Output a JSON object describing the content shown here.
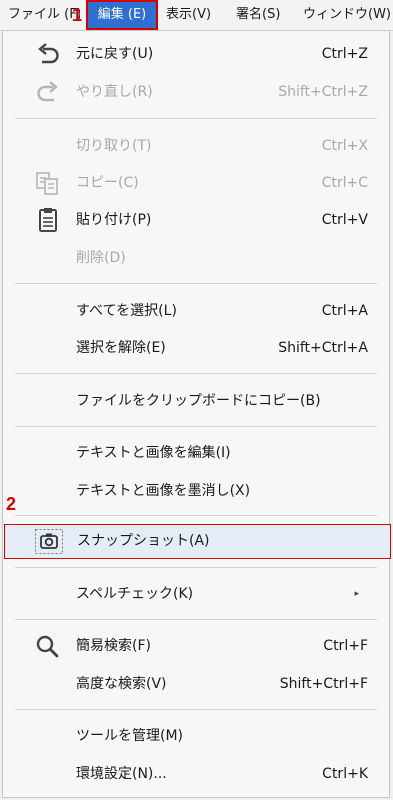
{
  "menubar": {
    "items": [
      {
        "label": "ファイル (F)"
      },
      {
        "label": "編集 (E)"
      },
      {
        "label": "表示(V)"
      },
      {
        "label": "署名(S)"
      },
      {
        "label": "ウィンドウ(W)"
      }
    ]
  },
  "annotations": {
    "step1": "1",
    "step2": "2"
  },
  "edit_menu": {
    "items": [
      {
        "label": "元に戻す(U)",
        "shortcut": "Ctrl+Z",
        "icon": "undo-icon",
        "enabled": true
      },
      {
        "label": "やり直し(R)",
        "shortcut": "Shift+Ctrl+Z",
        "icon": "redo-icon",
        "enabled": false
      },
      {
        "label": "切り取り(T)",
        "shortcut": "Ctrl+X",
        "enabled": false
      },
      {
        "label": "コピー(C)",
        "shortcut": "Ctrl+C",
        "icon": "copy-icon",
        "enabled": false
      },
      {
        "label": "貼り付け(P)",
        "shortcut": "Ctrl+V",
        "icon": "paste-icon",
        "enabled": true
      },
      {
        "label": "削除(D)",
        "enabled": false
      },
      {
        "label": "すべてを選択(L)",
        "shortcut": "Ctrl+A",
        "enabled": true
      },
      {
        "label": "選択を解除(E)",
        "shortcut": "Shift+Ctrl+A",
        "enabled": true
      },
      {
        "label": "ファイルをクリップボードにコピー(B)",
        "enabled": true
      },
      {
        "label": "テキストと画像を編集(I)",
        "enabled": true
      },
      {
        "label": "テキストと画像を墨消し(X)",
        "enabled": true
      },
      {
        "label": "スナップショット(A)",
        "icon": "camera-icon",
        "enabled": true,
        "highlighted": true
      },
      {
        "label": "スペルチェック(K)",
        "has_submenu": true,
        "submenu_arrow": "▸",
        "enabled": true
      },
      {
        "label": "簡易検索(F)",
        "shortcut": "Ctrl+F",
        "icon": "search-icon",
        "enabled": true
      },
      {
        "label": "高度な検索(V)",
        "shortcut": "Shift+Ctrl+F",
        "enabled": true
      },
      {
        "label": "ツールを管理(M)",
        "enabled": true
      },
      {
        "label": "環境設定(N)...",
        "shortcut": "Ctrl+K",
        "enabled": true
      }
    ]
  },
  "colors": {
    "accent": "#2f6fd0",
    "annotation_red": "#d40000",
    "highlight_bg": "#e4ecf6",
    "disabled_text": "#a8a8a8"
  }
}
